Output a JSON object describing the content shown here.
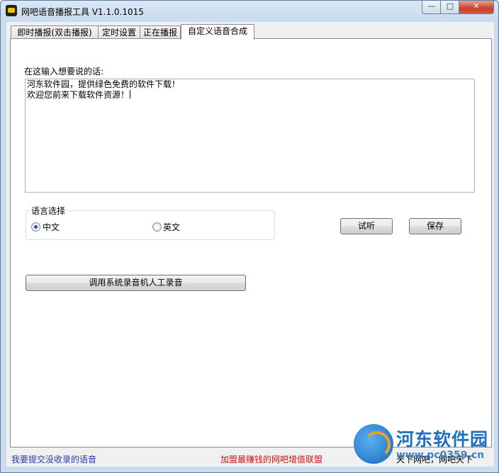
{
  "window": {
    "title": "网吧语音播报工具 V1.1.0.1015",
    "minimize_glyph": "—",
    "maximize_glyph": "□",
    "close_glyph": "✕"
  },
  "tabs": [
    {
      "label": "即时播报(双击播报)"
    },
    {
      "label": "定时设置"
    },
    {
      "label": "正在播报"
    },
    {
      "label": "自定义语音合成"
    }
  ],
  "active_tab": 3,
  "custom_tts": {
    "prompt_label": "在这输入想要说的话:",
    "text_lines": [
      "河东软件园，提供绿色免费的软件下载！",
      "欢迎您前来下载软件资源！"
    ],
    "language_group_label": "语言选择",
    "languages": [
      {
        "label": "中文",
        "checked": true
      },
      {
        "label": "英文",
        "checked": false
      }
    ],
    "preview_button": "试听",
    "save_button": "保存",
    "record_button": "调用系统录音机人工录音"
  },
  "status_bar": {
    "left_link": "我要提交没收录的语音",
    "center_link": "加盟最赚钱的网吧增值联盟",
    "right_text": "天下网吧，网吧天下",
    "colors": {
      "left": "#1f3ca8",
      "center": "#d21414",
      "right": "#000000"
    }
  },
  "watermark": {
    "name": "河东软件园",
    "url": "www.pc0359.cn"
  }
}
